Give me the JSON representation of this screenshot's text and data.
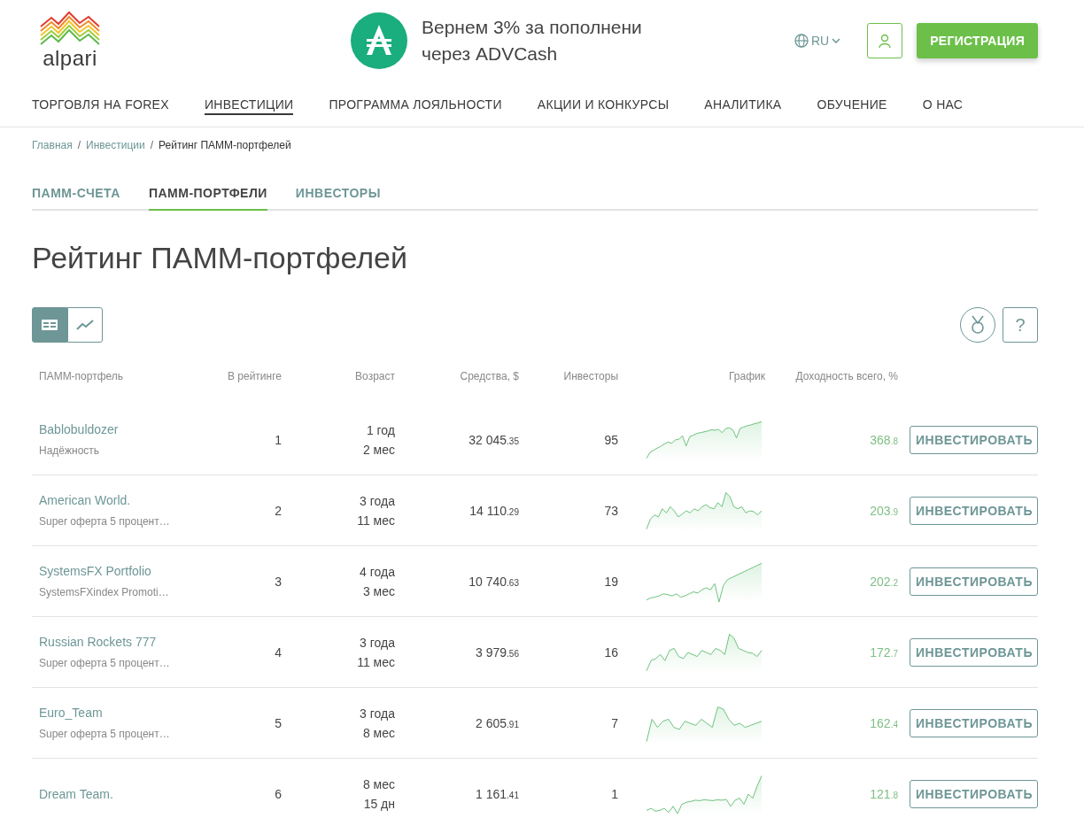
{
  "header": {
    "logo_text": "alpari",
    "promo": {
      "line1": "Вернем 3% за пополнени",
      "line2": "через ADVCash"
    },
    "language": "RU",
    "register_button": "РЕГИСТРАЦИЯ"
  },
  "nav": [
    {
      "label": "ТОРГОВЛЯ НА FOREX",
      "selected": false
    },
    {
      "label": "ИНВЕСТИЦИИ",
      "selected": true
    },
    {
      "label": "ПРОГРАММА ЛОЯЛЬНОСТИ",
      "selected": false
    },
    {
      "label": "АКЦИИ И КОНКУРСЫ",
      "selected": false
    },
    {
      "label": "АНАЛИТИКА",
      "selected": false
    },
    {
      "label": "ОБУЧЕНИЕ",
      "selected": false
    },
    {
      "label": "О НАС",
      "selected": false
    }
  ],
  "breadcrumb_separator": "/",
  "help_button": "?",
  "breadcrumbs": [
    {
      "label": "Главная",
      "link": true
    },
    {
      "label": "Инвестиции",
      "link": true
    },
    {
      "label": "Рейтинг ПАММ-портфелей",
      "link": false
    }
  ],
  "tabs": [
    {
      "label": "ПАММ-СЧЕТА",
      "selected": false
    },
    {
      "label": "ПАММ-ПОРТФЕЛИ",
      "selected": true
    },
    {
      "label": "ИНВЕСТОРЫ",
      "selected": false
    }
  ],
  "title": "Рейтинг ПАММ-портфелей",
  "view_toggle": [
    {
      "kind": "table",
      "selected": true
    },
    {
      "kind": "chart",
      "selected": false
    }
  ],
  "table": {
    "columns": [
      "ПАММ-портфель",
      "В рейтинге",
      "Возраст",
      "Средства, $",
      "Инвесторы",
      "График",
      "Доходность всего, %"
    ],
    "rows": [
      {
        "name": "Bablobuldozer",
        "subtitle": "Надёжность",
        "rank": "1",
        "age": [
          "1 год",
          "2 мес"
        ],
        "funds": "32 045",
        "funds_cents": ".35",
        "investors": "95",
        "return": "368",
        "return_decimal": ".8",
        "button": "ИНВЕСТИРОВАТЬ"
      },
      {
        "name": "American World.",
        "subtitle": "Super оферта 5 процент…",
        "rank": "2",
        "age": [
          "3 года",
          "11 мес"
        ],
        "funds": "14 110",
        "funds_cents": ".29",
        "investors": "73",
        "return": "203",
        "return_decimal": ".9",
        "button": "ИНВЕСТИРОВАТЬ"
      },
      {
        "name": "SystemsFX Portfolio",
        "subtitle": "SystemsFXindex Promoti…",
        "rank": "3",
        "age": [
          "4 года",
          "3 мес"
        ],
        "funds": "10 740",
        "funds_cents": ".63",
        "investors": "19",
        "return": "202",
        "return_decimal": ".2",
        "button": "ИНВЕСТИРОВАТЬ"
      },
      {
        "name": "Russian Rockets 777",
        "subtitle": "Super оферта 5 процент…",
        "rank": "4",
        "age": [
          "3 года",
          "11 мес"
        ],
        "funds": "3 979",
        "funds_cents": ".56",
        "investors": "16",
        "return": "172",
        "return_decimal": ".7",
        "button": "ИНВЕСТИРОВАТЬ"
      },
      {
        "name": "Euro_Team",
        "subtitle": "Super оферта 5 процент…",
        "rank": "5",
        "age": [
          "3 года",
          "8 мес"
        ],
        "funds": "2 605",
        "funds_cents": ".91",
        "investors": "7",
        "return": "162",
        "return_decimal": ".4",
        "button": "ИНВЕСТИРОВАТЬ"
      },
      {
        "name": "Dream Team.",
        "rank": "6",
        "age": [
          "8 мес",
          "15 дн"
        ],
        "funds": "1 161",
        "funds_cents": ".41",
        "investors": "1",
        "return": "121",
        "return_decimal": ".8",
        "button": "ИНВЕСТИРОВАТЬ"
      }
    ]
  }
}
